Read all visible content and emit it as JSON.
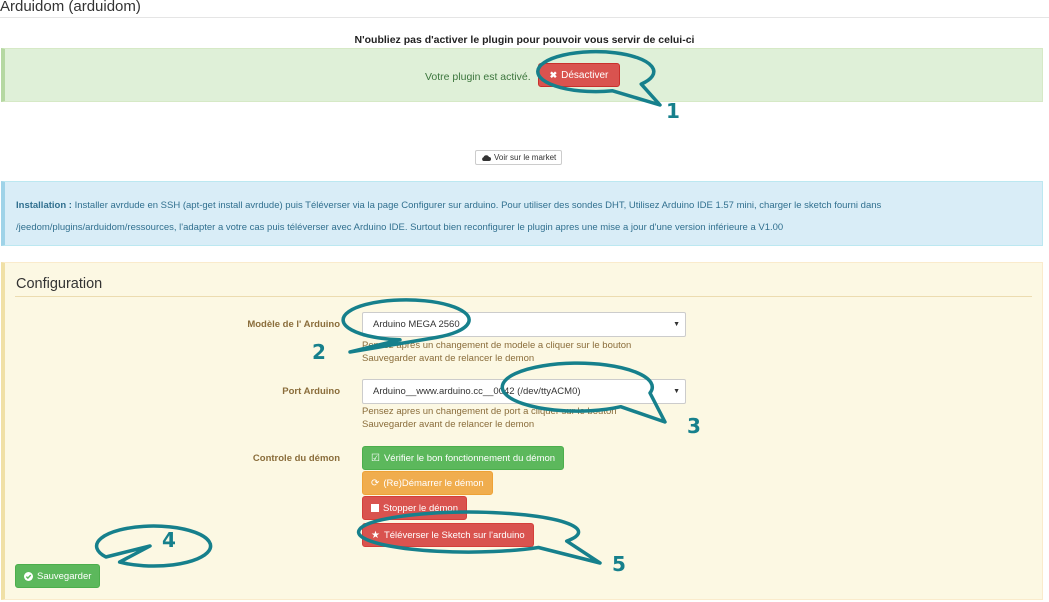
{
  "page": {
    "title": "Arduidom (arduidom)"
  },
  "warning": "N'oubliez pas d'activer le plugin pour pouvoir vous servir de celui-ci",
  "plugin_status": {
    "text": "Votre plugin est activé.",
    "deactivate_label": "Désactiver"
  },
  "market_label": "Voir sur le market",
  "install": {
    "label": "Installation :",
    "line1": "Installer avrdude en SSH (apt-get install avrdude) puis Téléverser via la page Configurer sur arduino. Pour utiliser des sondes DHT, Utilisez Arduino IDE 1.57 mini, charger le sketch fourni dans",
    "line2": "/jeedom/plugins/arduidom/ressources, l'adapter a votre cas puis téléverser avec Arduino IDE. Surtout bien reconfigurer le plugin apres une mise a jour d'une version inférieure a V1.00"
  },
  "config": {
    "title": "Configuration",
    "model": {
      "label": "Modèle de l' Arduino",
      "value": "Arduino MEGA 2560",
      "help1": "Pensez apres un changement de modele a cliquer sur le bouton",
      "help2": "Sauvegarder avant de relancer le demon"
    },
    "port": {
      "label": "Port Arduino",
      "value": "Arduino__www.arduino.cc__0042 (/dev/ttyACM0)",
      "help1": "Pensez apres un changement de port a cliquer sur le bouton",
      "help2": "Sauvegarder avant de relancer le demon"
    },
    "daemon": {
      "label": "Controle du démon",
      "check_label": "Vérifier le bon fonctionnement du démon",
      "restart_label": "(Re)Démarrer le démon",
      "stop_label": "Stopper le démon",
      "upload_label": "Téléverser le Sketch sur l'arduino"
    },
    "save_label": "Sauvegarder"
  },
  "annotations": [
    "1",
    "2",
    "3",
    "4",
    "5"
  ],
  "colors": {
    "annotation": "#16808c",
    "success": "#5cb85c",
    "danger": "#d9534f",
    "warning": "#f0ad4e"
  },
  "icons": {
    "deactivate": "close-icon",
    "market": "cloud-icon",
    "check": "checkbox-icon",
    "restart": "refresh-icon",
    "stop": "stop-icon",
    "upload": "star-icon",
    "save": "check-circle-icon"
  }
}
